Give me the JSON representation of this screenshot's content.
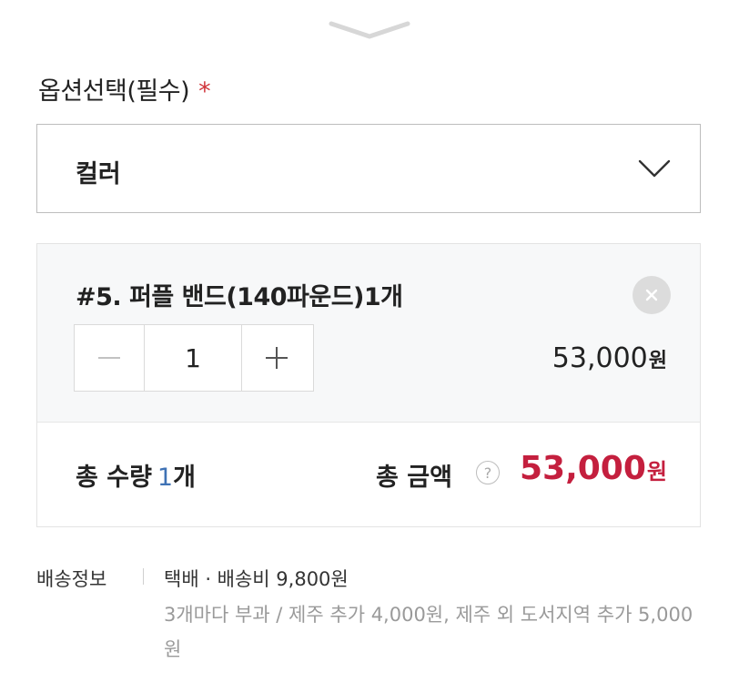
{
  "option": {
    "label": "옵션선택(필수)",
    "required_mark": "*",
    "select_value": "컬러"
  },
  "selected_item": {
    "name": "#5. 퍼플 밴드(140파운드)1개",
    "quantity": "1",
    "price": "53,000",
    "price_unit": "원"
  },
  "total": {
    "qty_label": "총 수량",
    "qty_value": "1",
    "qty_unit": "개",
    "amount_label": "총 금액",
    "help": "?",
    "amount_value": "53,000",
    "amount_unit": "원"
  },
  "shipping": {
    "label": "배송정보",
    "summary": "택배 · 배송비 9,800원",
    "note": "3개마다 부과 / 제주 추가 4,000원, 제주 외 도서지역 추가 5,000원"
  },
  "colors": {
    "accent_red": "#c41f3e",
    "required_red": "#d0343a",
    "qty_blue": "#3f72b5"
  }
}
